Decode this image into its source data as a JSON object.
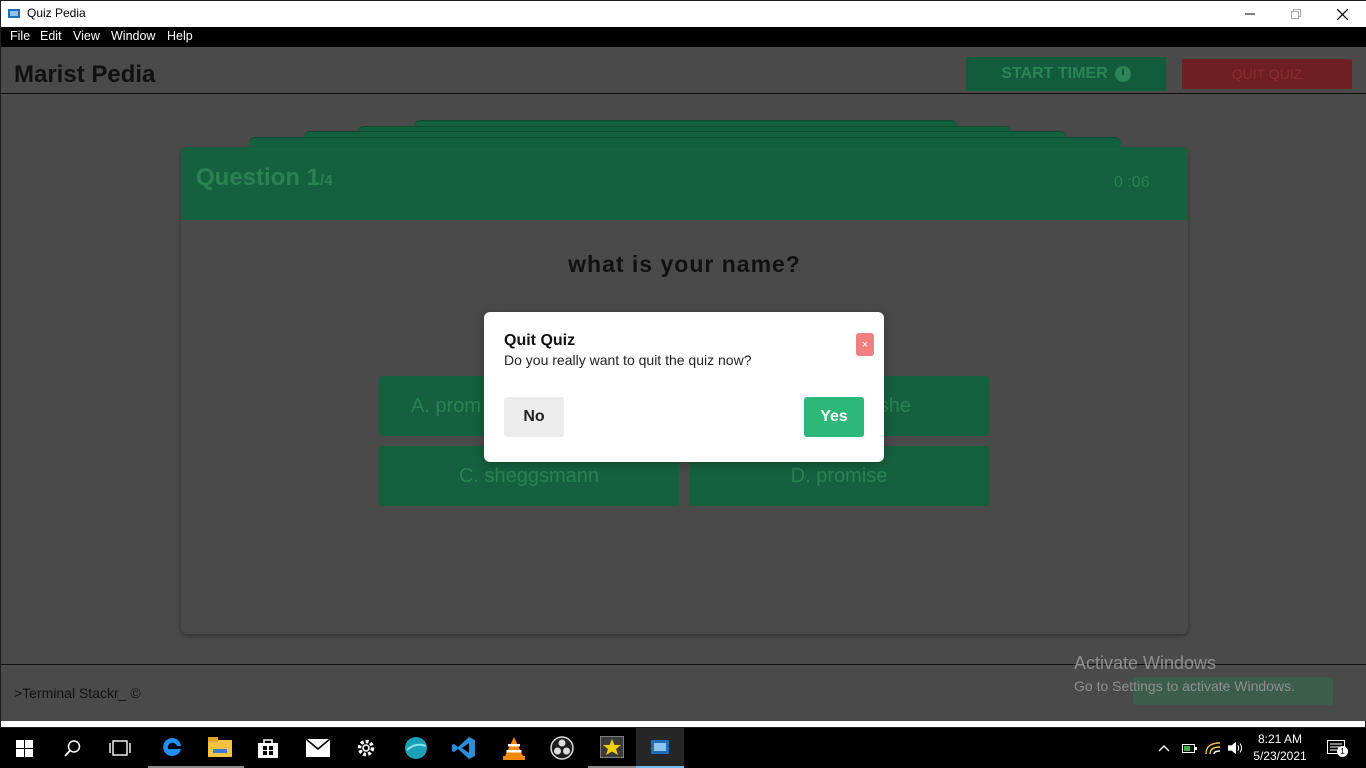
{
  "window": {
    "title": "Quiz Pedia",
    "controls": {
      "minimize": "—",
      "maximize": "❐",
      "close": "✕"
    }
  },
  "menu": [
    "File",
    "Edit",
    "View",
    "Window",
    "Help"
  ],
  "header": {
    "brand": "Marist Pedia",
    "start_timer_label": "START TIMER",
    "quit_quiz_label": "QUIT QUIZ"
  },
  "quiz": {
    "question_label": "Question 1",
    "question_total": "/4",
    "timer": "0 :06",
    "question_text": "what is your name?",
    "options": {
      "a": "A. prom",
      "b": "she",
      "c": "C. sheggsmann",
      "d": "D. promise"
    }
  },
  "footer": {
    "text": ">Terminal Stackr_ ©"
  },
  "watermark": {
    "title": "Activate Windows",
    "subtitle": "Go to Settings to activate Windows."
  },
  "modal": {
    "title": "Quit Quiz",
    "message": "Do you really want to quit the quiz now?",
    "close_label": "×",
    "no_label": "No",
    "yes_label": "Yes"
  },
  "taskbar": {
    "time": "8:21 AM",
    "date": "5/23/2021",
    "notification_count": "1",
    "apps": [
      "start-icon",
      "search-icon",
      "task-view-icon",
      "edge-icon",
      "file-explorer-icon",
      "store-icon",
      "mail-icon",
      "settings-icon",
      "browser-icon",
      "vscode-icon",
      "vlc-icon",
      "obs-icon",
      "starred-app-icon",
      "quiz-pedia-icon"
    ]
  },
  "colors": {
    "accent_green": "#2db87a",
    "dim_green": "#15613f",
    "overlay": "#4a4a4a",
    "close_red": "#f08080"
  }
}
